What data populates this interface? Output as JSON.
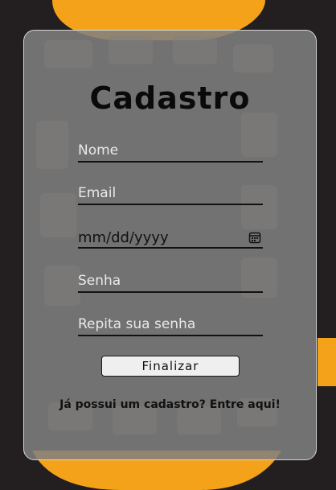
{
  "background": {
    "color": "#231f20",
    "accent": "#f5a21b",
    "icon": "shoe-sole-graphic"
  },
  "form": {
    "title": "Cadastro",
    "fields": [
      {
        "placeholder": "Nome"
      },
      {
        "placeholder": "Email"
      },
      {
        "value": "mm/dd/yyyy",
        "icon": "calendar-icon"
      },
      {
        "placeholder": "Senha"
      },
      {
        "placeholder": "Repita sua senha"
      }
    ],
    "submit_label": "Finalizar",
    "login_link": "Já possui um cadastro? Entre aqui!"
  }
}
